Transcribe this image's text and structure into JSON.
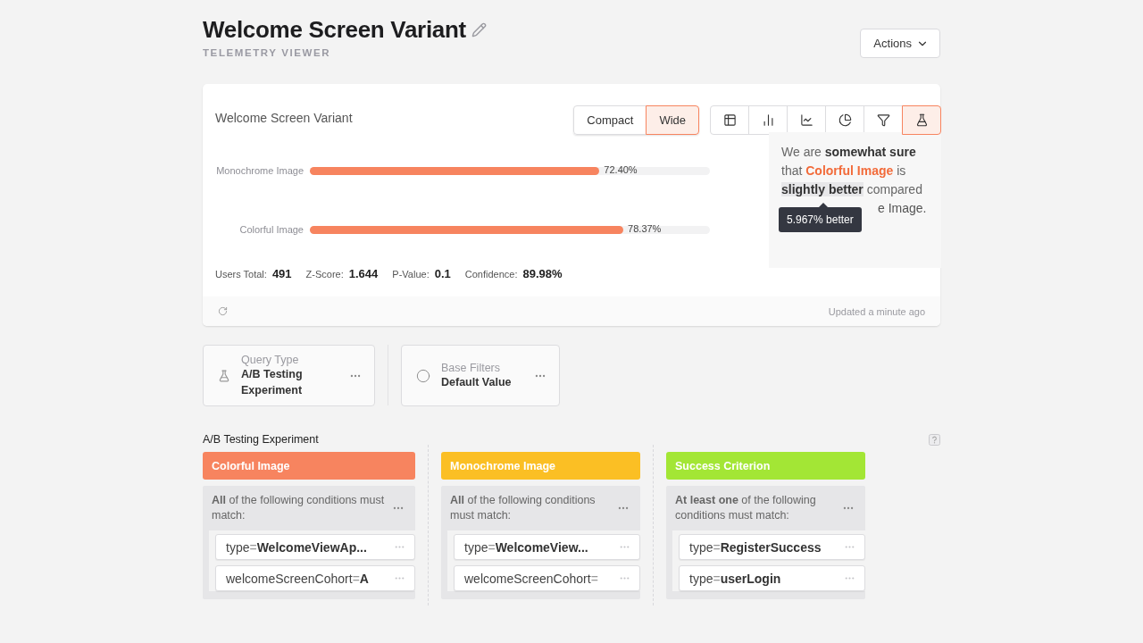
{
  "header": {
    "title": "Welcome Screen Variant",
    "subtitle": "TELEMETRY VIEWER",
    "actions_label": "Actions"
  },
  "chart_card": {
    "title": "Welcome Screen Variant",
    "width_toggle": [
      {
        "label": "Compact",
        "selected": false
      },
      {
        "label": "Wide",
        "selected": true
      }
    ],
    "views": [
      {
        "kind": "table",
        "selected": false
      },
      {
        "kind": "bars",
        "selected": false
      },
      {
        "kind": "line",
        "selected": false
      },
      {
        "kind": "pie",
        "selected": false
      },
      {
        "kind": "filter",
        "selected": false
      },
      {
        "kind": "flask",
        "selected": true
      }
    ],
    "bars": [
      {
        "label": "Monochrome Image",
        "level": 0.724,
        "reading": "72.40%"
      },
      {
        "label": "Colorful Image",
        "level": 0.7837,
        "reading": "78.37%"
      }
    ],
    "verdict": {
      "segments": [
        {
          "kind": "plain",
          "text": "We are "
        },
        {
          "kind": "strong",
          "text": "somewhat sure"
        },
        {
          "kind": "plain",
          "text": " that "
        },
        {
          "kind": "accent",
          "text": "Colorful Image"
        },
        {
          "kind": "plain",
          "text": " is "
        },
        {
          "kind": "marked",
          "text": "slightly better"
        },
        {
          "kind": "plain",
          "text": " compared"
        }
      ],
      "tail": "e Image.",
      "tooltip": "5.967% better"
    },
    "stats": [
      {
        "label": "Users Total:",
        "value": "491"
      },
      {
        "label": "Z-Score:",
        "value": "1.644"
      },
      {
        "label": "P-Value:",
        "value": "0.1"
      },
      {
        "label": "Confidence:",
        "value": "89.98%"
      }
    ],
    "footer": "Updated a minute ago"
  },
  "query_cards": [
    {
      "kind": "flask",
      "label": "Query Type",
      "value": "A/B Testing Experiment"
    },
    {
      "kind": "circle",
      "label": "Base Filters",
      "value": "Default Value"
    }
  ],
  "experiment": {
    "title": "A/B Testing Experiment",
    "groups": [
      {
        "title": "Colorful Image",
        "color": "#f7845f",
        "match": "**All** of the following conditions must match:",
        "conditions": [
          {
            "key": "type",
            "operator": "=",
            "value": "WelcomeViewAp..."
          },
          {
            "key": "welcomeScreenCohort",
            "operator": "=",
            "value": "A"
          }
        ]
      },
      {
        "title": "Monochrome Image",
        "color": "#fbbf24",
        "match": "**All** of the following conditions must match:",
        "conditions": [
          {
            "key": "type",
            "operator": "=",
            "value": "WelcomeView..."
          },
          {
            "key": "welcomeScreenCohort",
            "operator": "="
          }
        ]
      },
      {
        "title": "Success Criterion",
        "color": "#a3e635",
        "match": "**At least one** of the following conditions must match:",
        "conditions": [
          {
            "key": "type",
            "operator": "=",
            "value": "RegisterSuccess"
          },
          {
            "key": "type",
            "operator": "=",
            "value": "userLogin"
          }
        ]
      }
    ]
  }
}
